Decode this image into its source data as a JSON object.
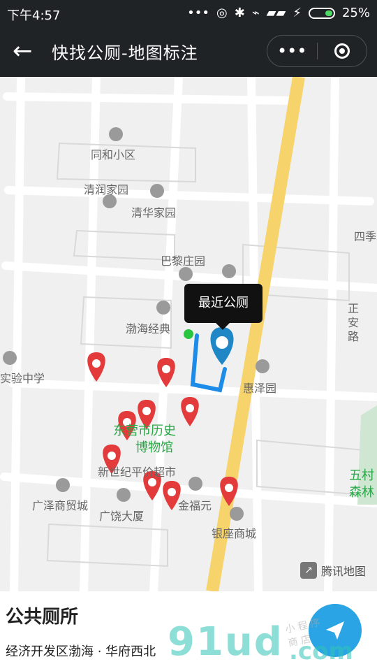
{
  "status_bar": {
    "time": "下午4:57",
    "battery": "25%"
  },
  "nav": {
    "title": "快找公厕-地图标注"
  },
  "map": {
    "tooltip": "最近公厕",
    "labels": {
      "tonghe": "同和小区",
      "qingrun": "清润家园",
      "qinghua": "清华家园",
      "bali": "巴黎庄园",
      "bohai": "渤海经典",
      "huize": "惠泽园",
      "shiyan": "实验中学",
      "guangze": "广泽商贸城",
      "guangrao": "广饶大厦",
      "jinfuyuan": "金福元",
      "yinzuo": "银座商城",
      "xinshiji": "新世纪平价超市",
      "siji": "四季",
      "zhengan": "正安路",
      "wucun": "五村",
      "senlin": "森林",
      "museum_line1": "东营市历史",
      "museum_line2": "博物馆"
    },
    "brand": "腾讯地图",
    "colors": {
      "marker_red": "#e33b3b",
      "marker_blue": "#1f87c6",
      "road_yellow": "#f7d36b",
      "route_blue": "#1d8ce8"
    }
  },
  "panel": {
    "title": "公共厕所",
    "address": "经济开发区渤海 · 华府西北"
  },
  "watermark": {
    "brand": "91ud",
    "tld": ".com",
    "tagline": "小 程 序 商 店"
  }
}
